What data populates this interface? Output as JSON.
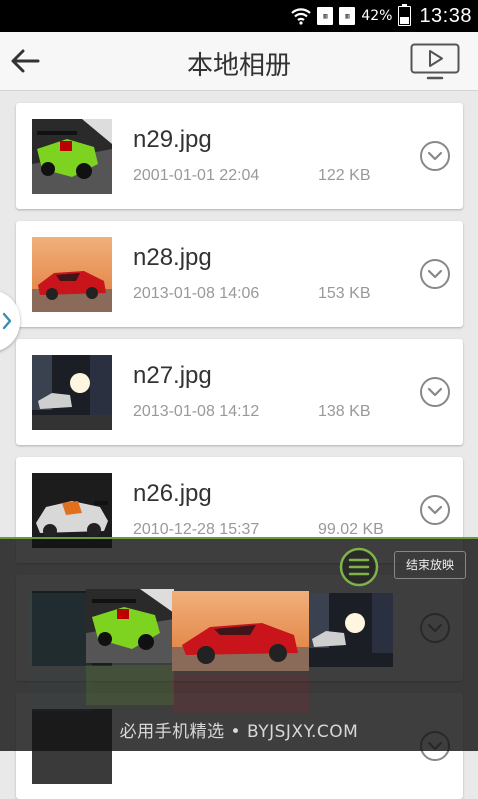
{
  "status_bar": {
    "battery_percent": "42%",
    "time": "13:38",
    "icons": [
      "wifi-icon",
      "sim1-icon",
      "sim2-icon",
      "battery-icon"
    ]
  },
  "header": {
    "title": "本地相册",
    "icons": [
      "back-arrow-icon",
      "slideshow-play-icon"
    ]
  },
  "files": [
    {
      "name": "n29.jpg",
      "date": "2001-01-01 22:04",
      "size": "122 KB"
    },
    {
      "name": "n28.jpg",
      "date": "2013-01-08 14:06",
      "size": "153 KB"
    },
    {
      "name": "n27.jpg",
      "date": "2013-01-08 14:12",
      "size": "138 KB"
    },
    {
      "name": "n26.jpg",
      "date": "2010-12-28 15:37",
      "size": "99.02 KB"
    },
    {
      "name": "",
      "date": "",
      "size": ""
    },
    {
      "name": "",
      "date": "",
      "size": ""
    }
  ],
  "slideshow": {
    "end_label": "结束放映",
    "icons": [
      "menu-icon"
    ]
  },
  "watermark": "必用手机精选 • BYJSJXY.COM",
  "colors": {
    "accent_green": "#6a9a3a",
    "title_text": "#333333",
    "meta_text": "#999999"
  }
}
